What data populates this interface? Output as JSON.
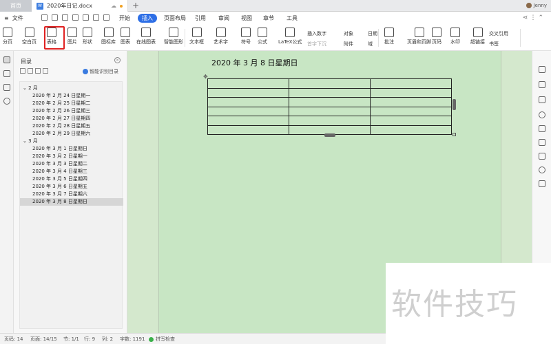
{
  "titlebar": {
    "home_tab": "首页",
    "doc_icon": "W",
    "doc_name": "2020年日记.docx",
    "add_tab": "+",
    "user": "Jenny"
  },
  "menubar": {
    "file_label": "文件",
    "tabs": [
      {
        "label": "开始",
        "active": false
      },
      {
        "label": "插入",
        "active": true
      },
      {
        "label": "页面布局",
        "active": false
      },
      {
        "label": "引用",
        "active": false
      },
      {
        "label": "审阅",
        "active": false
      },
      {
        "label": "视图",
        "active": false
      },
      {
        "label": "章节",
        "active": false
      },
      {
        "label": "工具",
        "active": false
      }
    ]
  },
  "ribbon": {
    "buttons": [
      {
        "label": "分页",
        "icon": "page-break-icon"
      },
      {
        "label": "空白页",
        "icon": "blank-page-icon"
      },
      {
        "label": "表格",
        "icon": "table-icon",
        "highlighted": true
      },
      {
        "label": "图片",
        "icon": "picture-icon"
      },
      {
        "label": "形状",
        "icon": "shape-icon"
      },
      {
        "label": "图标库",
        "icon": "icon-library-icon"
      },
      {
        "label": "图表",
        "icon": "chart-icon"
      },
      {
        "label": "在线图表",
        "icon": "online-chart-icon"
      },
      {
        "label": "智能图形",
        "icon": "smart-graphic-icon"
      },
      {
        "label": "文本框",
        "icon": "text-box-icon"
      },
      {
        "label": "艺术字",
        "icon": "word-art-icon"
      },
      {
        "label": "符号",
        "icon": "symbol-icon"
      },
      {
        "label": "公式",
        "icon": "formula-icon"
      },
      {
        "label": "LaTeX公式",
        "icon": "latex-icon"
      },
      {
        "label": "批注",
        "icon": "comment-icon"
      },
      {
        "label": "页眉和页脚",
        "icon": "header-footer-icon"
      },
      {
        "label": "页码",
        "icon": "page-number-icon"
      },
      {
        "label": "水印",
        "icon": "watermark-icon"
      },
      {
        "label": "超链接",
        "icon": "hyperlink-icon"
      }
    ],
    "small": {
      "insert_number": "插入数字",
      "first_char_sink": "首字下沉",
      "object": "对象",
      "attachment": "附件",
      "date": "日期",
      "field": "域",
      "cross_ref": "交叉引用",
      "bookmark": "书签"
    }
  },
  "toc": {
    "title": "目录",
    "smart_label": "智能识别目录",
    "items": [
      {
        "text": "2 月",
        "level": 1
      },
      {
        "text": "2020 年 2 月 24 日星期一",
        "level": 2
      },
      {
        "text": "2020 年 2 月 25 日星期二",
        "level": 2
      },
      {
        "text": "2020 年 2 月 26 日星期三",
        "level": 2
      },
      {
        "text": "2020 年 2 月 27 日星期四",
        "level": 2
      },
      {
        "text": "2020 年 2 月 28 日星期五",
        "level": 2
      },
      {
        "text": "2020 年 2 月 29 日星期六",
        "level": 2
      },
      {
        "text": "3 月",
        "level": 1
      },
      {
        "text": "2020 年 3 月 1 日星期日",
        "level": 2
      },
      {
        "text": "2020 年 3 月 2 日星期一",
        "level": 2
      },
      {
        "text": "2020 年 3 月 3 日星期二",
        "level": 2
      },
      {
        "text": "2020 年 3 月 4 日星期三",
        "level": 2
      },
      {
        "text": "2020 年 3 月 5 日星期四",
        "level": 2
      },
      {
        "text": "2020 年 3 月 6 日星期五",
        "level": 2
      },
      {
        "text": "2020 年 3 月 7 日星期六",
        "level": 2
      },
      {
        "text": "2020 年 3 月 8 日星期日",
        "level": 2
      }
    ]
  },
  "document": {
    "heading": "2020 年 3 月 8 日星期日",
    "table": {
      "rows": 6,
      "cols": 3
    }
  },
  "statusbar": {
    "page_num": "页码: 14",
    "page": "页面: 14/15",
    "section": "节: 1/1",
    "row": "行: 9",
    "column": "列: 2",
    "word_count": "字数: 1191",
    "spell_check": "拼写检查"
  },
  "watermark": {
    "text": "软件技巧"
  },
  "colors": {
    "accent": "#2e6fe6",
    "highlight_box": "#e02020",
    "page_bg": "#c8e6c4"
  }
}
